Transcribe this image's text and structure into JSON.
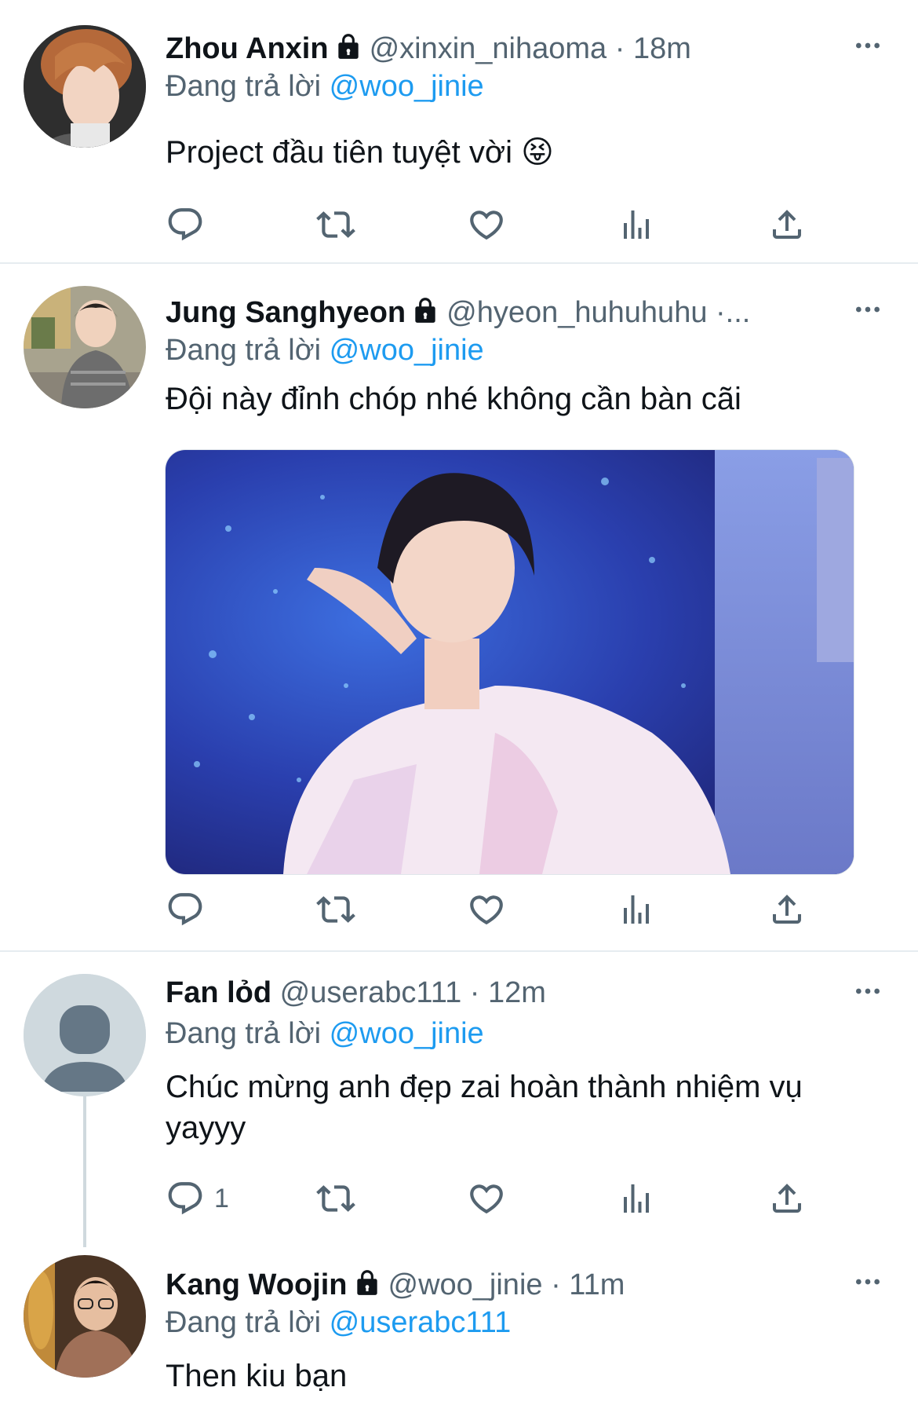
{
  "reply_prefix": "Đang trả lời",
  "tweets": [
    {
      "name": "Zhou Anxin",
      "handle": "@xinxin_nihaoma",
      "separator": "·",
      "time": "18m",
      "reply_to": "@woo_jinie",
      "text": "Project đầu tiên tuyệt vời 😝",
      "locked": true,
      "reply_count": ""
    },
    {
      "name": "Jung Sanghyeon",
      "handle": "@hyeon_huhuhuhu",
      "separator": "·...",
      "time": "",
      "reply_to": "@woo_jinie",
      "text": "Đội này đỉnh chóp nhé không cần bàn cãi",
      "locked": true,
      "has_media": true,
      "reply_count": ""
    },
    {
      "name": "Fan lỏd",
      "handle": "@userabc111",
      "separator": "·",
      "time": "12m",
      "reply_to": "@woo_jinie",
      "text": "Chúc mừng anh đẹp zai hoàn thành nhiệm vụ yayyy",
      "locked": false,
      "reply_count": "1"
    },
    {
      "name": "Kang Woojin",
      "handle": "@woo_jinie",
      "separator": "·",
      "time": "11m",
      "reply_to": "@userabc111",
      "text": "Then kiu bạn",
      "locked": true,
      "reply_count": ""
    }
  ],
  "icons": {
    "reply": "reply-icon",
    "retweet": "retweet-icon",
    "like": "heart-icon",
    "views": "views-icon",
    "share": "share-icon",
    "more": "more-icon",
    "lock": "lock-icon"
  },
  "colors": {
    "mention": "#1d9bf0",
    "secondary_text": "#536471",
    "divider": "#e6ecf0"
  }
}
